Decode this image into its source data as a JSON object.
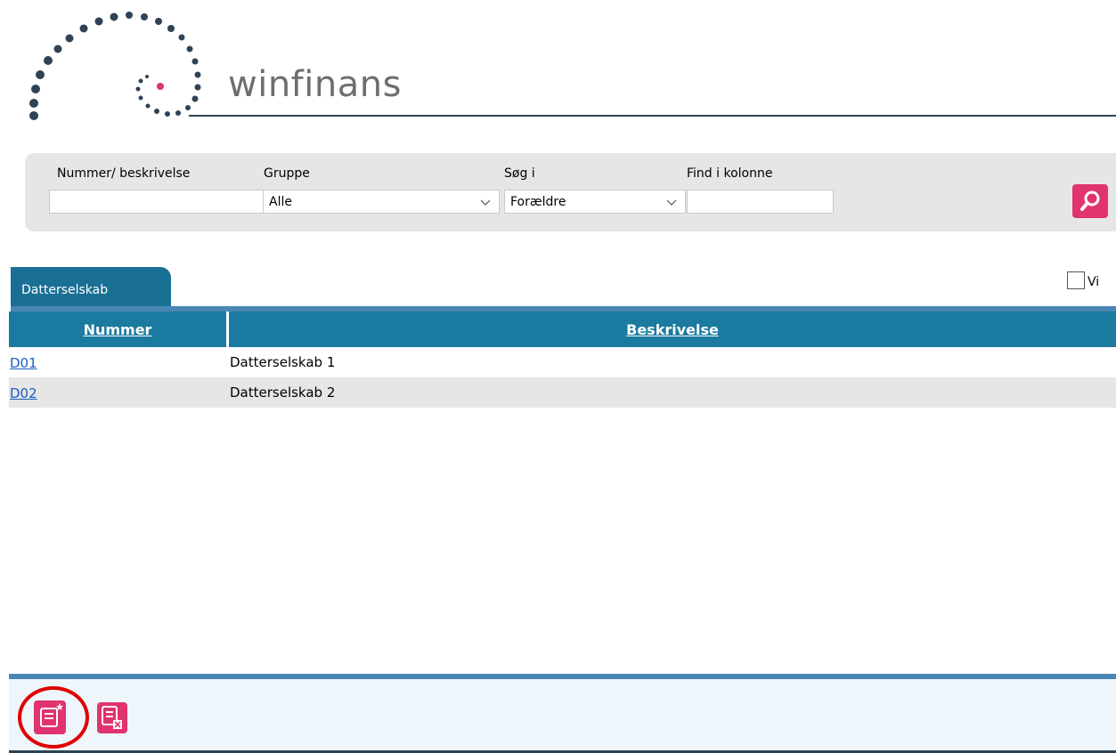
{
  "brand": {
    "logo_text": "winfinans",
    "colors": {
      "dots": "#2f4256",
      "accent": "#e0336f",
      "text": "#6d6e71"
    }
  },
  "search": {
    "number_label": "Nummer/ beskrivelse",
    "number_value": "",
    "group_label": "Gruppe",
    "group_value": "Alle",
    "searchin_label": "Søg i",
    "searchin_value": "Forældre",
    "findcol_label": "Find i kolonne",
    "findcol_value": "",
    "search_icon": "search-icon"
  },
  "tabs": [
    {
      "label": "Datterselskab"
    }
  ],
  "vis_label": "Vi",
  "table": {
    "columns": [
      "Nummer",
      "Beskrivelse"
    ],
    "rows": [
      {
        "nummer": "D01",
        "beskrivelse": "Datterselskab 1"
      },
      {
        "nummer": "D02",
        "beskrivelse": "Datterselskab 2"
      }
    ]
  },
  "footer": {
    "new_icon": "new-record-icon",
    "delete_icon": "delete-record-icon"
  }
}
